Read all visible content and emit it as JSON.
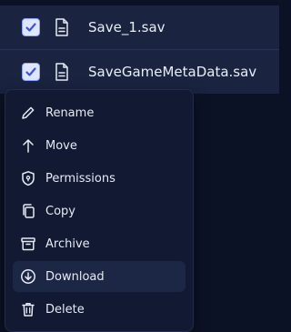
{
  "files": [
    {
      "name": "Save_1.sav",
      "checked": true,
      "icon": "file-icon"
    },
    {
      "name": "SaveGameMetaData.sav",
      "checked": true,
      "icon": "file-icon"
    }
  ],
  "menu": {
    "items": [
      {
        "label": "Rename",
        "icon": "pencil-icon"
      },
      {
        "label": "Move",
        "icon": "arrow-up-icon"
      },
      {
        "label": "Permissions",
        "icon": "shield-icon"
      },
      {
        "label": "Copy",
        "icon": "copy-icon"
      },
      {
        "label": "Archive",
        "icon": "archive-icon"
      },
      {
        "label": "Download",
        "icon": "download-icon",
        "highlighted": true
      },
      {
        "label": "Delete",
        "icon": "trash-icon"
      }
    ]
  },
  "colors": {
    "background": "#0c1226",
    "row": "#1a2340",
    "menu": "#121a33",
    "menu_highlight": "#1c2645",
    "checkbox_fill": "#dfe6ff",
    "checkbox_check": "#3d53d9"
  }
}
